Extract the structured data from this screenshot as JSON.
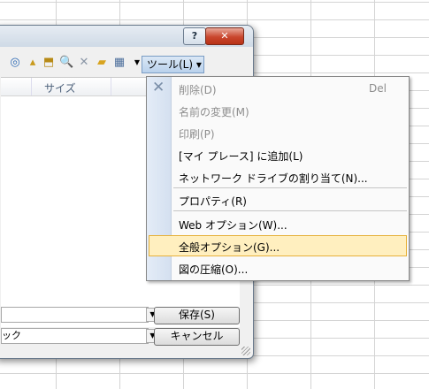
{
  "window": {
    "help_label": "?",
    "close_label": "✕"
  },
  "toolbar": {
    "tools_label": "ツール(L) ▾",
    "icons": [
      "back-icon",
      "up-folder-icon",
      "search-web-icon",
      "delete-icon",
      "new-folder-icon",
      "views-icon"
    ]
  },
  "list": {
    "column_size": "サイズ"
  },
  "fields": {
    "filename_value": "",
    "filetype_value": "ック"
  },
  "buttons": {
    "save": "保存(S)",
    "cancel": "キャンセル"
  },
  "menu": {
    "items": [
      {
        "label": "削除(D)",
        "shortcut": "Del",
        "disabled": true
      },
      {
        "label": "名前の変更(M)",
        "disabled": true
      },
      {
        "label": "印刷(P)",
        "disabled": true
      },
      {
        "label": "[マイ プレース] に追加(L)",
        "disabled": false
      },
      {
        "label": "ネットワーク ドライブの割り当て(N)...",
        "disabled": false
      },
      {
        "label": "プロパティ(R)",
        "disabled": false
      },
      {
        "label": "Web オプション(W)...",
        "disabled": false
      },
      {
        "label": "全般オプション(G)...",
        "disabled": false,
        "highlighted": true
      },
      {
        "label": "図の圧縮(O)...",
        "disabled": false
      }
    ]
  },
  "colors": {
    "highlight": "#ffefbf",
    "highlight_border": "#e6b13a",
    "close_red": "#c9462d"
  }
}
